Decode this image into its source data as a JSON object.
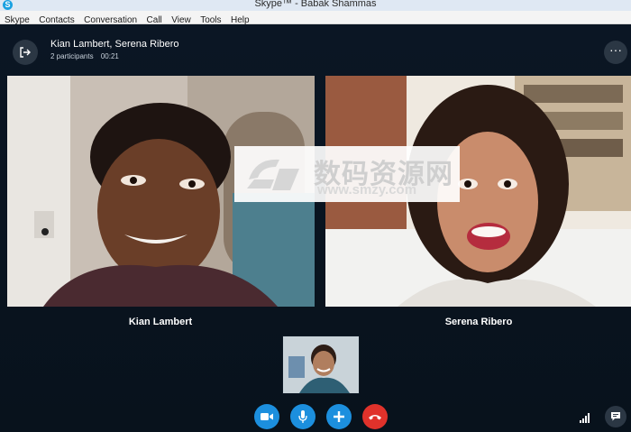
{
  "window": {
    "title": "Skype™ - Babak Shammas",
    "app_icon_letter": "S"
  },
  "menu": [
    "Skype",
    "Contacts",
    "Conversation",
    "Call",
    "View",
    "Tools",
    "Help"
  ],
  "call": {
    "participants_title": "Kian Lambert, Serena Ribero",
    "participants_count": "2 participants",
    "duration": "00:21",
    "more_label": "···"
  },
  "videos": [
    {
      "name": "Kian Lambert"
    },
    {
      "name": "Serena Ribero"
    }
  ],
  "watermark": {
    "text": "数码资源网",
    "url": "www.smzy.com"
  },
  "colors": {
    "background": "#0a1420",
    "call_button": "#1c8fde",
    "end_call_button": "#e0322b",
    "round_button": "#2b3744"
  },
  "controls": [
    "video-camera-icon",
    "microphone-icon",
    "plus-icon",
    "end-call-icon",
    "signal-strength-icon",
    "chat-icon"
  ]
}
